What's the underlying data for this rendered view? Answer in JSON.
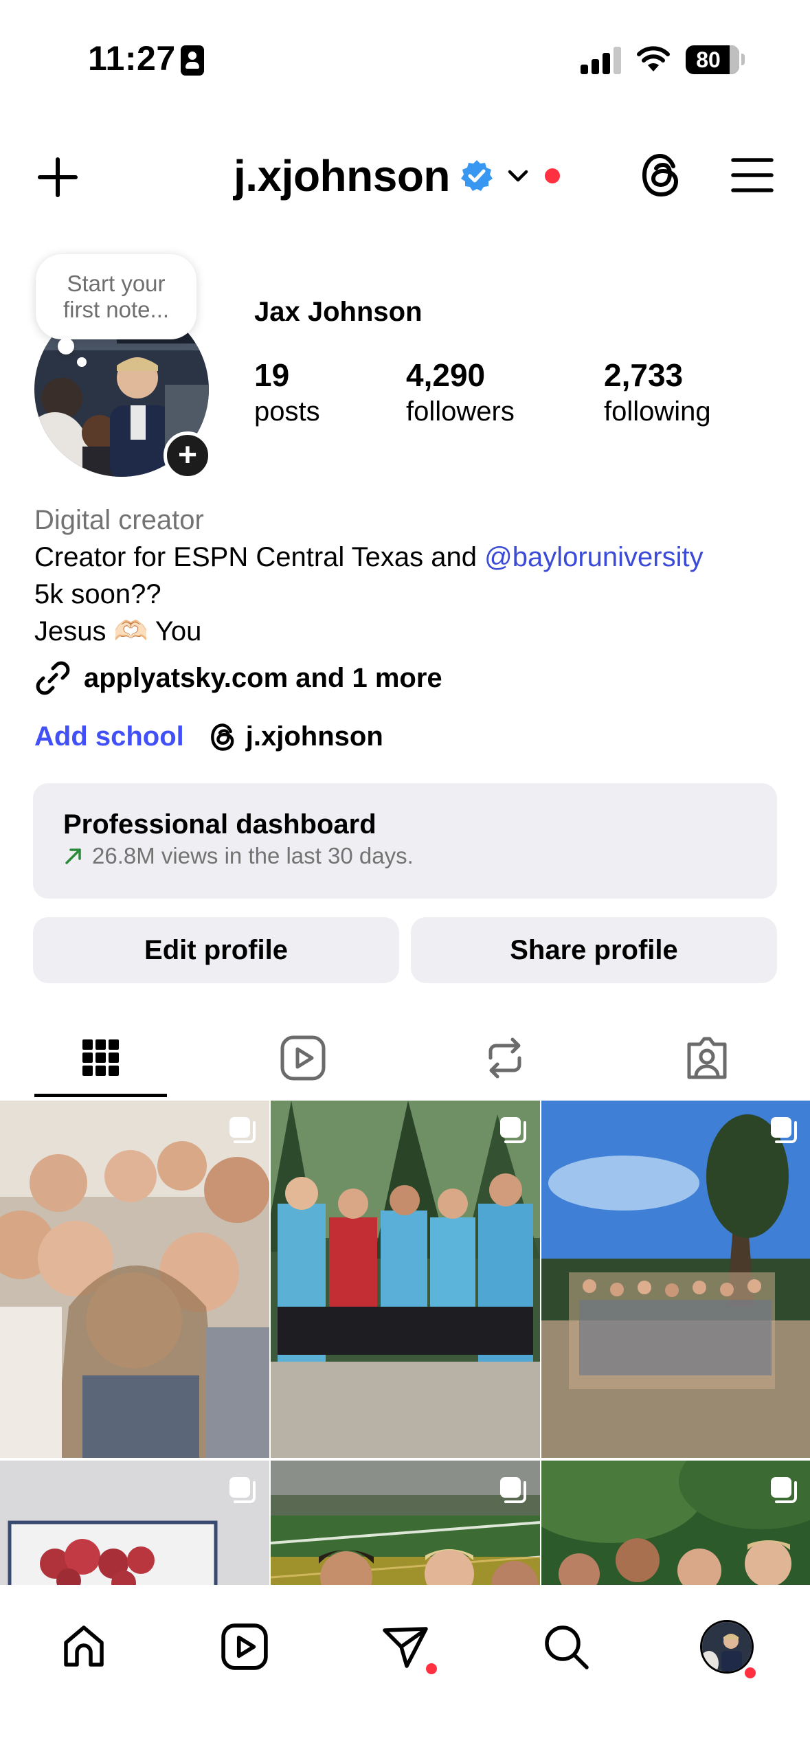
{
  "status_bar": {
    "time": "11:27",
    "battery": "80"
  },
  "header": {
    "username": "j.xjohnson",
    "icons": {
      "create": "plus-icon",
      "verified": "verified-badge-icon",
      "switch_account": "chevron-down-icon",
      "threads": "threads-icon",
      "menu": "hamburger-menu-icon"
    },
    "notification_color": "#ff3040"
  },
  "profile": {
    "note_placeholder": "Start your first note...",
    "full_name": "Jax Johnson",
    "stats": [
      {
        "value": "19",
        "label": "posts"
      },
      {
        "value": "4,290",
        "label": "followers"
      },
      {
        "value": "2,733",
        "label": "following"
      }
    ],
    "category": "Digital creator",
    "bio_line1_text": "Creator for ESPN Central Texas and ",
    "bio_mention": "@bayloruniversity",
    "bio_line2": "5k soon??",
    "bio_line3_start": "Jesus ",
    "bio_line3_emoji": "🫶🏻",
    "bio_line3_end": " You",
    "link": "applyatsky.com and 1 more",
    "add_school": "Add school",
    "threads_handle": "j.xjohnson"
  },
  "dashboard": {
    "title": "Professional dashboard",
    "subtitle": "26.8M views in the last 30 days.",
    "trend_color": "#2a8a3a"
  },
  "actions": {
    "edit_profile": "Edit profile",
    "share_profile": "Share profile"
  },
  "tabs": [
    {
      "icon": "grid-icon",
      "active": true
    },
    {
      "icon": "reels-icon",
      "active": false
    },
    {
      "icon": "reposts-icon",
      "active": false
    },
    {
      "icon": "tagged-icon",
      "active": false
    }
  ],
  "bottom_nav": [
    {
      "icon": "home-icon"
    },
    {
      "icon": "reels-icon"
    },
    {
      "icon": "direct-messages-icon",
      "badge": true
    },
    {
      "icon": "search-icon"
    },
    {
      "icon": "profile-avatar",
      "badge": true
    }
  ],
  "colors": {
    "link_blue": "#3b4bd8",
    "button_bg": "#efeff3",
    "verified_blue": "#3897f0"
  }
}
